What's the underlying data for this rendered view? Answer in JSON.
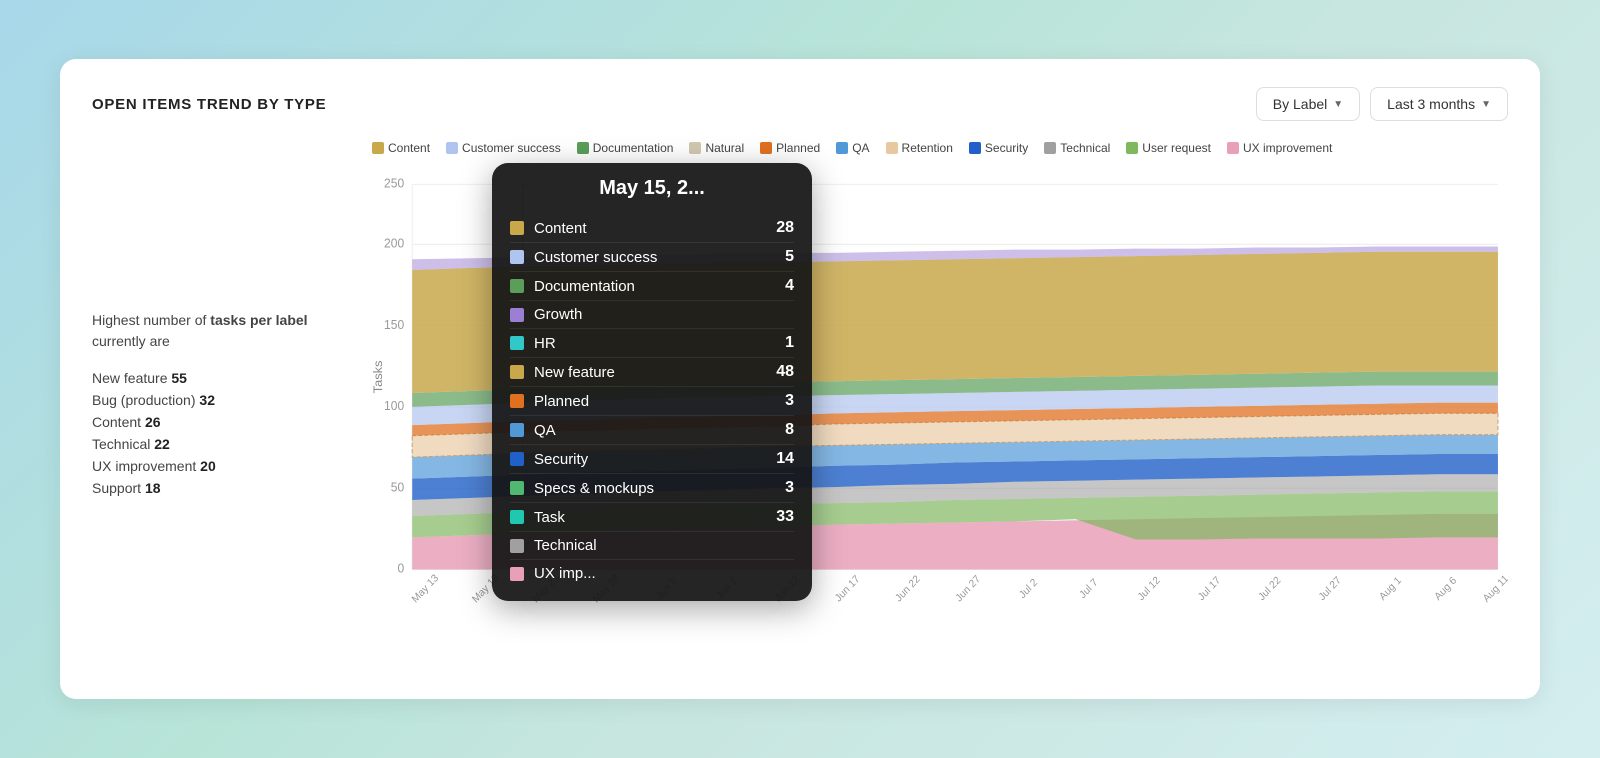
{
  "card": {
    "title": "OPEN ITEMS TREND BY TYPE"
  },
  "header": {
    "by_label_btn": "By Label",
    "last_3_months_btn": "Last 3 months"
  },
  "summary": {
    "prefix": "Highest number of ",
    "bold": "tasks per label",
    "suffix": " currently are"
  },
  "stats": [
    {
      "label": "New feature",
      "value": "55"
    },
    {
      "label": "Bug (production)",
      "value": "32"
    },
    {
      "label": "Content",
      "value": "26"
    },
    {
      "label": "Technical",
      "value": "22"
    },
    {
      "label": "UX improvement",
      "value": "20"
    },
    {
      "label": "Support",
      "value": "18"
    }
  ],
  "legend": [
    {
      "label": "Content",
      "color": "#c8a84b"
    },
    {
      "label": "Customer success",
      "color": "#b0c4f0"
    },
    {
      "label": "Documentation",
      "color": "#5a9e5a"
    },
    {
      "label": "Natural",
      "color": "#d0c8b0"
    },
    {
      "label": "Planned",
      "color": "#e07020"
    },
    {
      "label": "QA",
      "color": "#5098d8"
    },
    {
      "label": "Retention",
      "color": "#e8c8a0"
    },
    {
      "label": "Security",
      "color": "#2060c8"
    },
    {
      "label": "Technical",
      "color": "#a0a0a0"
    },
    {
      "label": "User request",
      "color": "#80b860"
    },
    {
      "label": "UX improvement",
      "color": "#e8a0b8"
    }
  ],
  "x_labels": [
    "May 13",
    "May 18",
    "May 23",
    "May 28",
    "Jun 2",
    "Jun 7",
    "Jun 12",
    "Jun 17",
    "Jun 22",
    "Jun 27",
    "Jul 2",
    "Jul 7",
    "Jul 12",
    "Jul 17",
    "Jul 22",
    "Jul 27",
    "Aug 1",
    "Aug 6",
    "Aug 11"
  ],
  "y_labels": [
    "0",
    "50",
    "100",
    "150",
    "200",
    "250"
  ],
  "tooltip": {
    "date": "May 15, 2...",
    "items": [
      {
        "label": "Content",
        "color": "#c8a84b",
        "value": "28"
      },
      {
        "label": "Customer success",
        "color": "#b0c4f0",
        "value": "5"
      },
      {
        "label": "Documentation",
        "color": "#5a9e5a",
        "value": "4"
      },
      {
        "label": "Growth",
        "color": "#9b7fd4",
        "value": ""
      },
      {
        "label": "HR",
        "color": "#30c8c8",
        "value": "1"
      },
      {
        "label": "New feature",
        "color": "#c8a84b",
        "value": "48"
      },
      {
        "label": "Planned",
        "color": "#e07020",
        "value": "3"
      },
      {
        "label": "QA",
        "color": "#5098d8",
        "value": "8"
      },
      {
        "label": "Security",
        "color": "#2060c8",
        "value": "14"
      },
      {
        "label": "Specs & mockups",
        "color": "#50b870",
        "value": "3"
      },
      {
        "label": "Task",
        "color": "#20c8b0",
        "value": "33"
      },
      {
        "label": "Technical",
        "color": "#a0a0a0",
        "value": ""
      },
      {
        "label": "UX imp...",
        "color": "#e8a0b8",
        "value": ""
      }
    ]
  }
}
